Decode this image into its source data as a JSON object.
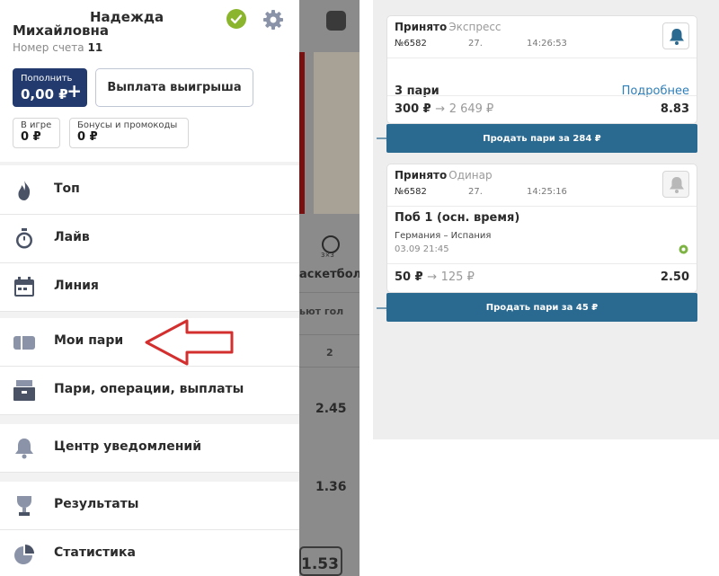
{
  "left_panel": {
    "user": {
      "first_name": "Надежда",
      "last_name": "Михайловна",
      "account_label": "Номер счета",
      "account_number": "11"
    },
    "deposit": {
      "label": "Пополнить",
      "amount": "0,00 ₽",
      "plus": "+"
    },
    "payout_button": "Выплата выигрыша",
    "balances": [
      {
        "label": "В игре",
        "value": "0 ₽"
      },
      {
        "label": "Бонусы и промокоды",
        "value": "0 ₽"
      }
    ],
    "menu": [
      {
        "label": "Топ",
        "icon": "fire-icon"
      },
      {
        "label": "Лайв",
        "icon": "stopwatch-icon"
      },
      {
        "label": "Линия",
        "icon": "calendar-icon"
      },
      {
        "label": "Мои пари",
        "icon": "ticket-icon"
      },
      {
        "label": "Пари, операции, выплаты",
        "icon": "cash-register-icon"
      },
      {
        "label": "Центр уведомлений",
        "icon": "bell-icon"
      },
      {
        "label": "Результаты",
        "icon": "trophy-icon"
      },
      {
        "label": "Статистика",
        "icon": "pie-chart-icon"
      }
    ],
    "background": {
      "sport_label": "аскетбол 3",
      "sport_icon_text": "3×3",
      "market_label": "ьют гол",
      "column_header": "2",
      "odds": [
        "2.45",
        "1.36",
        "1.53"
      ]
    },
    "colors": {
      "accent": "#223a6e",
      "check": "#8ab52c",
      "arrow": "#d32f2f"
    }
  },
  "right_panel": {
    "bets": [
      {
        "status": "Принято",
        "type": "Экспресс",
        "number": "№6582",
        "day": "27.",
        "time": "14:26:53",
        "title": "3 пари",
        "details_link": "Подробнее",
        "stake": "300 ₽",
        "arrow": "→",
        "potential_win": "2 649 ₽",
        "coef": "8.83",
        "sell_label": "Продать пари за 284 ₽"
      },
      {
        "status": "Принято",
        "type": "Одинар",
        "number": "№6582",
        "day": "27.",
        "time": "14:25:16",
        "title": "Поб 1 (осн. время)",
        "match": "Германия – Испания",
        "match_date": "03.09 21:45",
        "stake": "50 ₽",
        "arrow": "→",
        "potential_win": "125 ₽",
        "coef": "2.50",
        "sell_label": "Продать пари за 45 ₽"
      }
    ],
    "colors": {
      "sell_button": "#2a6990",
      "link": "#2f7fb8"
    }
  }
}
